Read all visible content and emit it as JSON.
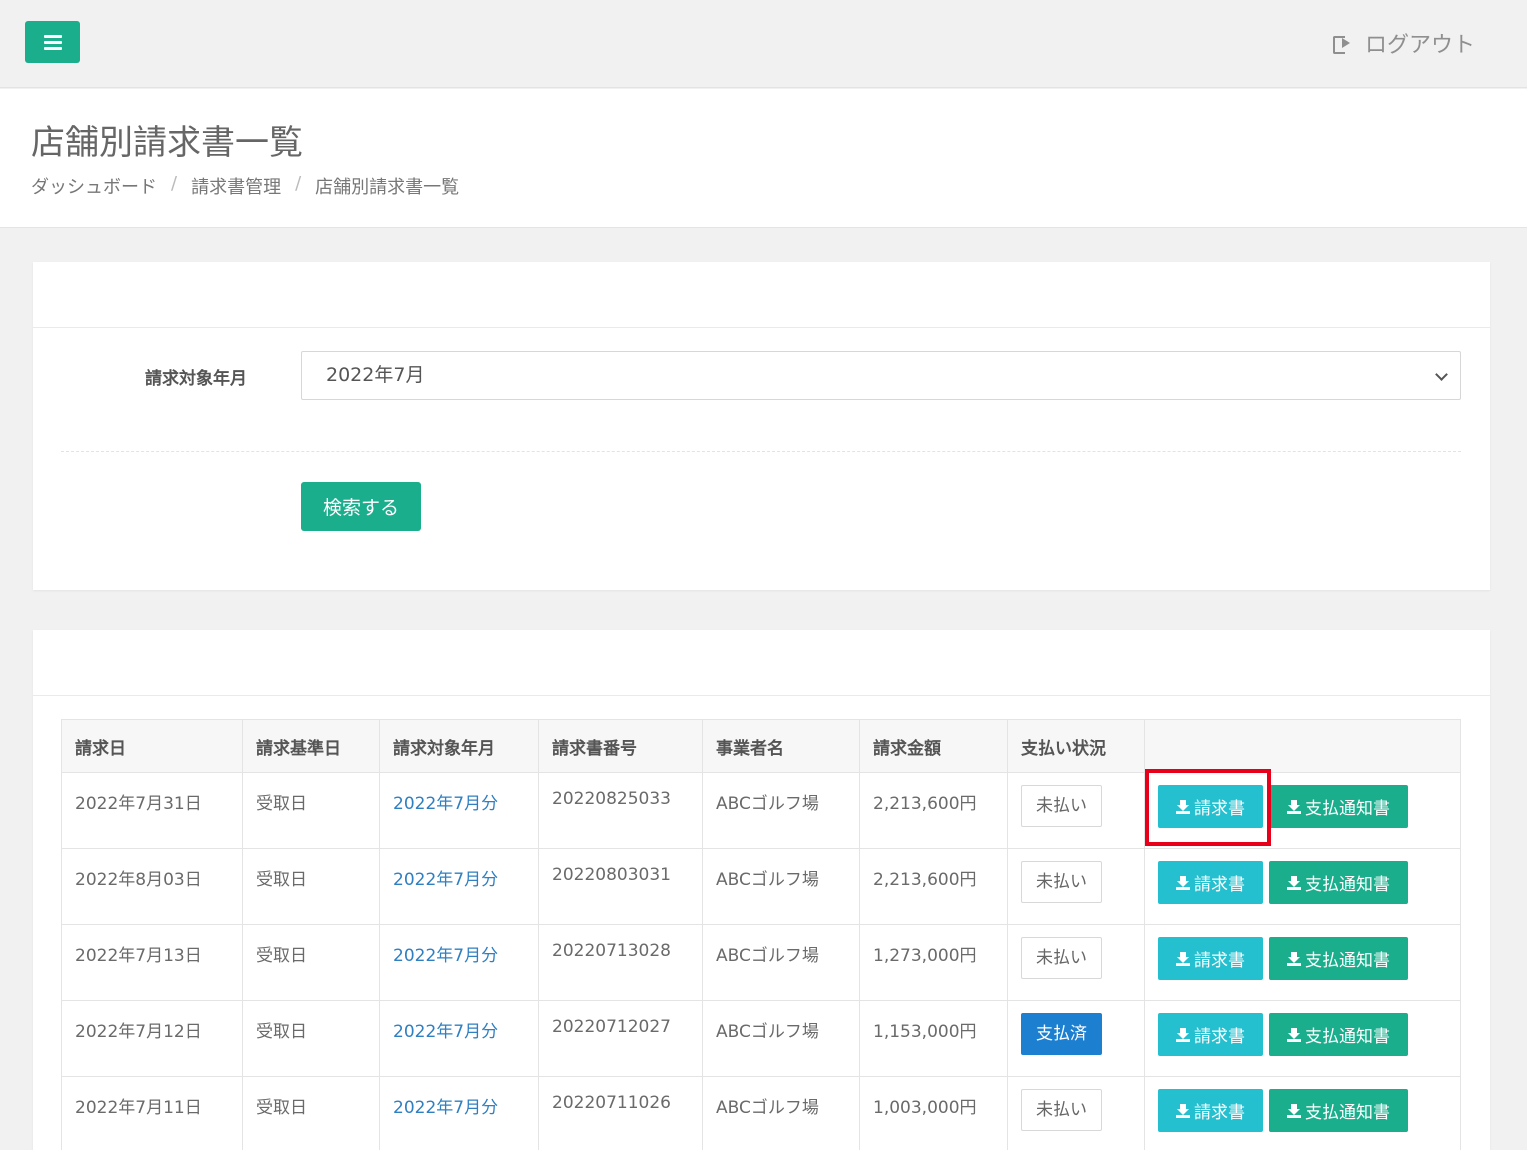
{
  "topbar": {
    "logout_label": "ログアウト"
  },
  "header": {
    "title": "店舗別請求書一覧",
    "breadcrumb": [
      "ダッシュボード",
      "請求書管理",
      "店舗別請求書一覧"
    ]
  },
  "search": {
    "label": "請求対象年月",
    "selected": "2022年7月",
    "button": "検索する"
  },
  "table": {
    "columns": [
      "請求日",
      "請求基準日",
      "請求対象年月",
      "請求書番号",
      "事業者名",
      "請求金額",
      "支払い状況",
      ""
    ],
    "invoice_btn": "請求書",
    "payment_btn": "支払通知書",
    "rows": [
      {
        "date": "2022年7月31日",
        "base": "受取日",
        "target": "2022年7月分",
        "number": "20220825033",
        "company": "ABCゴルフ場",
        "amount": "2,213,600円",
        "status": "未払い"
      },
      {
        "date": "2022年8月03日",
        "base": "受取日",
        "target": "2022年7月分",
        "number": "20220803031",
        "company": "ABCゴルフ場",
        "amount": "2,213,600円",
        "status": "未払い"
      },
      {
        "date": "2022年7月13日",
        "base": "受取日",
        "target": "2022年7月分",
        "number": "20220713028",
        "company": "ABCゴルフ場",
        "amount": "1,273,000円",
        "status": "未払い"
      },
      {
        "date": "2022年7月12日",
        "base": "受取日",
        "target": "2022年7月分",
        "number": "20220712027",
        "company": "ABCゴルフ場",
        "amount": "1,153,000円",
        "status": "支払済"
      },
      {
        "date": "2022年7月11日",
        "base": "受取日",
        "target": "2022年7月分",
        "number": "20220711026",
        "company": "ABCゴルフ場",
        "amount": "1,003,000円",
        "status": "未払い"
      }
    ]
  }
}
